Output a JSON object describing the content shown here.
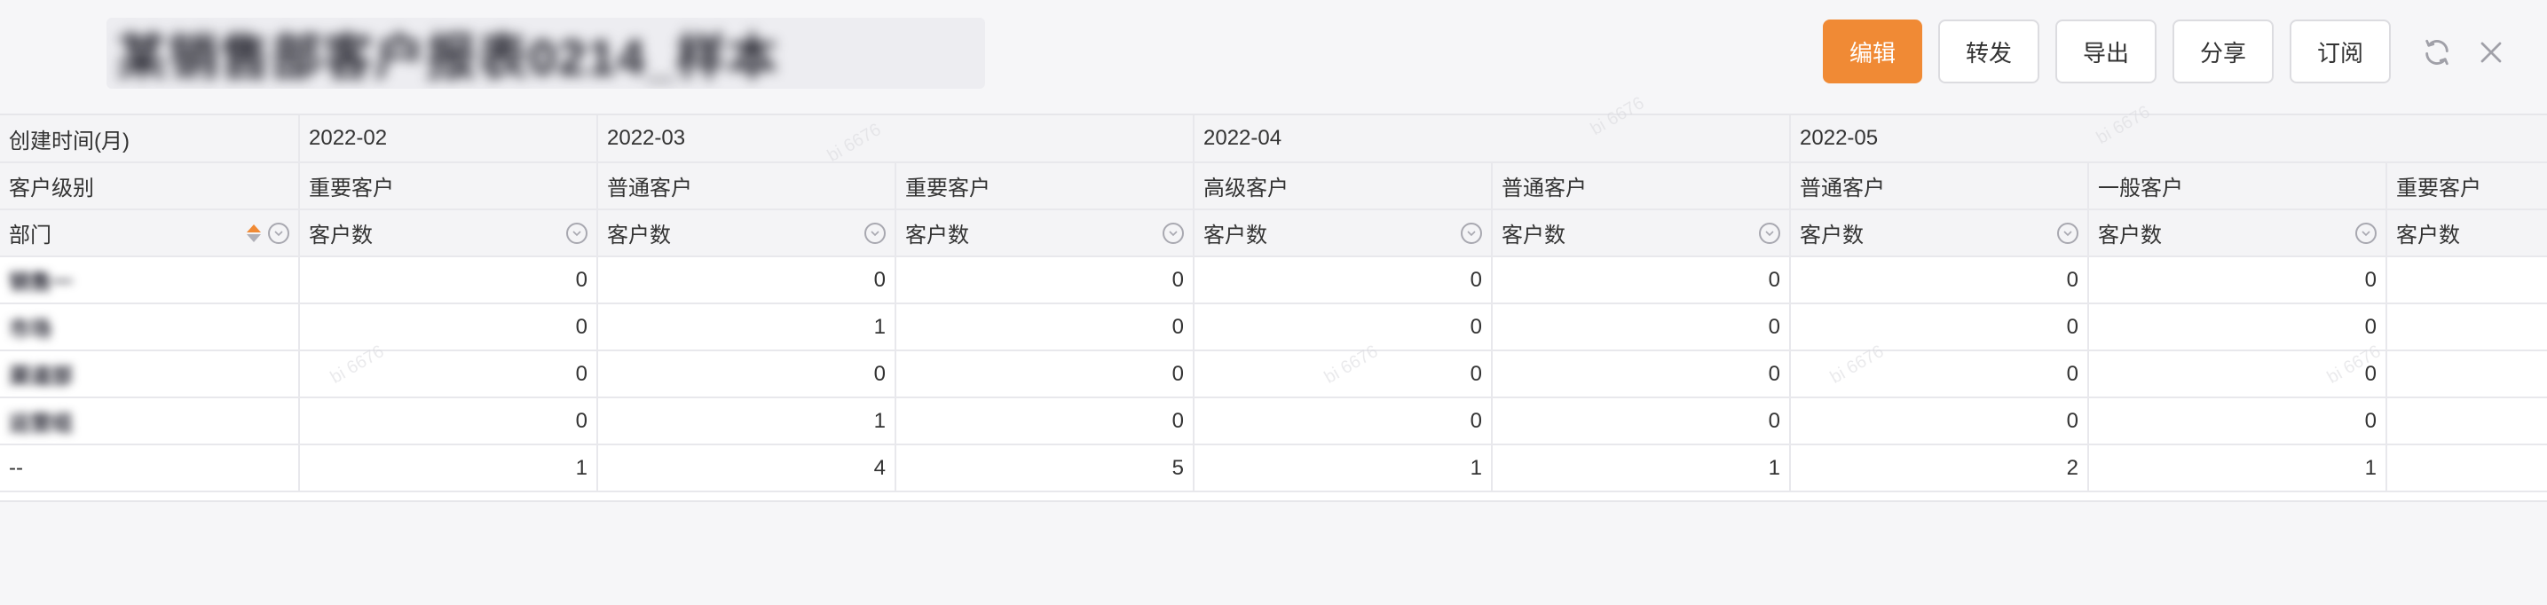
{
  "header": {
    "title": "某销售部客户报表0214_样本",
    "buttons": {
      "edit": "编辑",
      "forward": "转发",
      "export": "导出",
      "share": "分享",
      "subscribe": "订阅"
    }
  },
  "table": {
    "row_headers": {
      "created_month": "创建时间(月)",
      "customer_level": "客户级别",
      "department": "部门"
    },
    "months": [
      "2022-02",
      "2022-03",
      "2022-04",
      "2022-05"
    ],
    "levels": [
      "重要客户",
      "普通客户",
      "重要客户",
      "高级客户",
      "普通客户",
      "普通客户",
      "一般客户",
      "重要客户"
    ],
    "measure": "客户数",
    "rows": [
      {
        "dept": "销售一",
        "values": [
          "0",
          "0",
          "0",
          "0",
          "0",
          "0",
          "0",
          ""
        ]
      },
      {
        "dept": "市场",
        "values": [
          "0",
          "1",
          "0",
          "0",
          "0",
          "0",
          "0",
          ""
        ]
      },
      {
        "dept": "渠道部",
        "values": [
          "0",
          "0",
          "0",
          "0",
          "0",
          "0",
          "0",
          ""
        ]
      },
      {
        "dept": "运营组",
        "values": [
          "0",
          "1",
          "0",
          "0",
          "0",
          "0",
          "0",
          ""
        ]
      },
      {
        "dept": "--",
        "values": [
          "1",
          "4",
          "5",
          "1",
          "1",
          "2",
          "1",
          ""
        ]
      }
    ]
  },
  "watermark": "bi 6676"
}
